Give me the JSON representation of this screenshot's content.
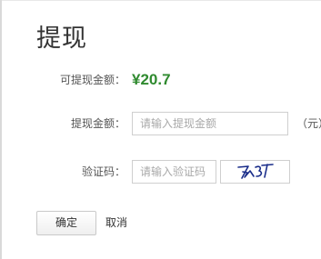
{
  "page": {
    "title": "提现"
  },
  "balance": {
    "label": "可提现金额：",
    "value": "¥20.7"
  },
  "amount": {
    "label": "提现金额：",
    "placeholder": "请输入提现金额",
    "value": "",
    "unit": "（元）"
  },
  "captcha": {
    "label": "验证码：",
    "placeholder": "请输入验证码",
    "value": "",
    "image_text": "7⁄3T"
  },
  "actions": {
    "confirm_label": "确定",
    "cancel_label": "取消"
  },
  "colors": {
    "balance": "#2f8a2f",
    "captcha_ink": "#1a2d8a"
  }
}
